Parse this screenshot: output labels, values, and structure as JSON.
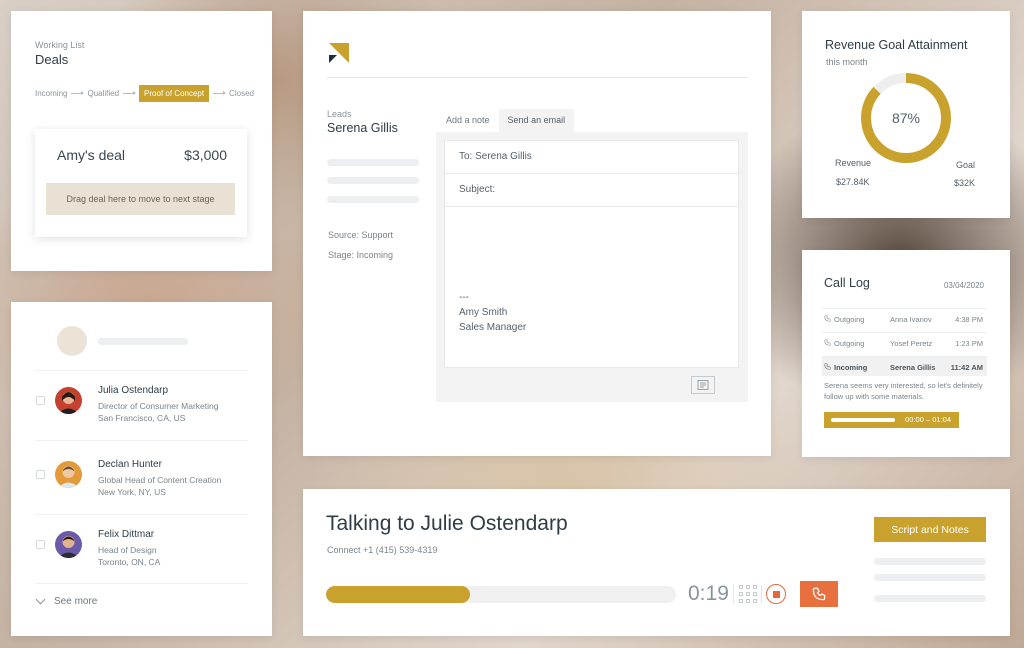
{
  "deals_card": {
    "eyebrow": "Working List",
    "title": "Deals",
    "stages": [
      "Incoming",
      "Qualified",
      "Proof of Concept",
      "Closed"
    ],
    "active_stage": "Proof of Concept",
    "deal": {
      "name": "Amy's deal",
      "value": "$3,000"
    },
    "drop_hint": "Drag deal here to move to next stage",
    "accent": "#c9a22e"
  },
  "contacts_card": {
    "contacts": [
      {
        "name": "Julia Ostendarp",
        "title": "Director of Consumer Marketing",
        "location": "San Francisco, CA, US",
        "avatar_color": "#c4402f"
      },
      {
        "name": "Declan Hunter",
        "title": "Global Head of Content Creation",
        "location": "New York, NY, US",
        "avatar_color": "#e29a3a"
      },
      {
        "name": "Felix Dittmar",
        "title": "Head of Design",
        "location": "Toronto, ON, CA",
        "avatar_color": "#6b5aa8"
      }
    ],
    "see_more": "See more"
  },
  "leads_card": {
    "eyebrow": "Leads",
    "name": "Serena Gillis",
    "source": "Source: Support",
    "stage": "Stage: Incoming",
    "tabs": [
      {
        "label": "Add a note",
        "active": false
      },
      {
        "label": "Send an email",
        "active": true
      }
    ],
    "email": {
      "to": "To: Serena Gillis",
      "subject": "Subject:",
      "signature_sep": "---",
      "signature_name": "Amy Smith",
      "signature_title": "Sales Manager"
    }
  },
  "revenue_card": {
    "title": "Revenue Goal Attainment",
    "subtitle": "this month",
    "percent_label": "87%",
    "percent": 87,
    "revenue_label": "Revenue",
    "revenue_value": "$27.84K",
    "goal_label": "Goal",
    "goal_value": "$32K"
  },
  "call_log": {
    "title": "Call Log",
    "date": "03/04/2020",
    "calls": [
      {
        "direction": "Outgoing",
        "contact": "Anna Ivanov",
        "time": "4:38 PM",
        "active": false
      },
      {
        "direction": "Outgoing",
        "contact": "Yosef Peretz",
        "time": "1:23 PM",
        "active": false
      },
      {
        "direction": "Incoming",
        "contact": "Serena Gillis",
        "time": "11:42 AM",
        "active": true
      }
    ],
    "note": "Serena seems very interested, so let's definitely follow up with some materials.",
    "player_time": "00:00 – 01:04",
    "player_progress": 0.5
  },
  "talking_card": {
    "title": "Talking to Julie Ostendarp",
    "connect": "Connect +1 (415) 539-4319",
    "elapsed": "0:19",
    "progress": 0.41,
    "script_button": "Script and Notes",
    "end_call_color": "#e8703f"
  }
}
